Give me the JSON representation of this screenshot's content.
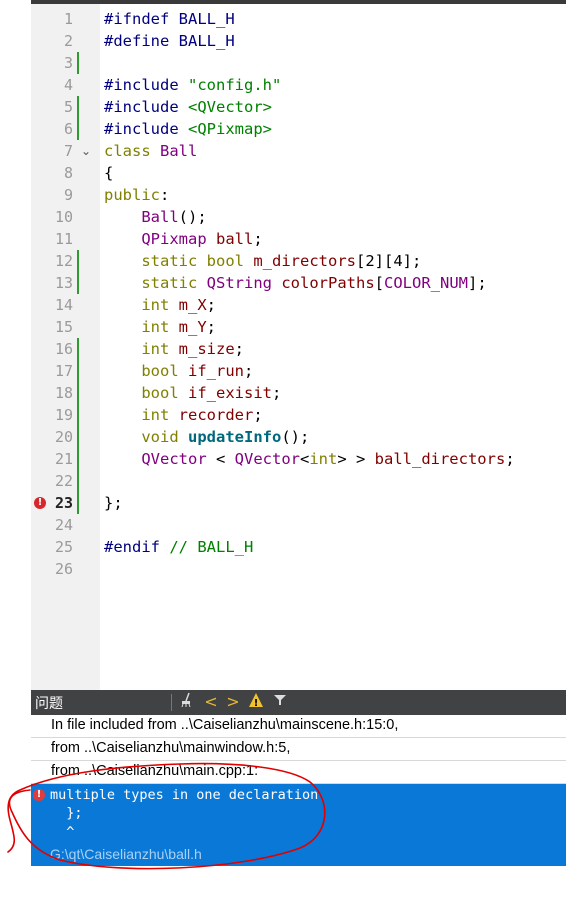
{
  "editor": {
    "lines": [
      {
        "n": "1",
        "mod": false,
        "tokens": [
          {
            "c": "pre",
            "t": "#ifndef BALL_H"
          }
        ]
      },
      {
        "n": "2",
        "mod": false,
        "tokens": [
          {
            "c": "pre",
            "t": "#define BALL_H"
          }
        ]
      },
      {
        "n": "3",
        "mod": true,
        "tokens": []
      },
      {
        "n": "4",
        "mod": false,
        "tokens": [
          {
            "c": "pre",
            "t": "#include "
          },
          {
            "c": "str",
            "t": "\"config.h\""
          }
        ]
      },
      {
        "n": "5",
        "mod": true,
        "tokens": [
          {
            "c": "pre",
            "t": "#include "
          },
          {
            "c": "str",
            "t": "<QVector>"
          }
        ]
      },
      {
        "n": "6",
        "mod": true,
        "tokens": [
          {
            "c": "pre",
            "t": "#include "
          },
          {
            "c": "str",
            "t": "<QPixmap>"
          }
        ]
      },
      {
        "n": "7",
        "mod": false,
        "fold": true,
        "tokens": [
          {
            "c": "kw",
            "t": "class "
          },
          {
            "c": "type",
            "t": "Ball"
          }
        ]
      },
      {
        "n": "8",
        "mod": false,
        "tokens": [
          {
            "c": "plain",
            "t": "{"
          }
        ]
      },
      {
        "n": "9",
        "mod": false,
        "tokens": [
          {
            "c": "kw",
            "t": "public"
          },
          {
            "c": "plain",
            "t": ":"
          }
        ]
      },
      {
        "n": "10",
        "mod": false,
        "tokens": [
          {
            "c": "plain",
            "t": "    "
          },
          {
            "c": "type",
            "t": "Ball"
          },
          {
            "c": "plain",
            "t": "();"
          }
        ]
      },
      {
        "n": "11",
        "mod": false,
        "tokens": [
          {
            "c": "plain",
            "t": "    "
          },
          {
            "c": "type",
            "t": "QPixmap"
          },
          {
            "c": "plain",
            "t": " "
          },
          {
            "c": "field",
            "t": "ball"
          },
          {
            "c": "plain",
            "t": ";"
          }
        ]
      },
      {
        "n": "12",
        "mod": true,
        "tokens": [
          {
            "c": "plain",
            "t": "    "
          },
          {
            "c": "kw",
            "t": "static"
          },
          {
            "c": "plain",
            "t": " "
          },
          {
            "c": "kw",
            "t": "bool"
          },
          {
            "c": "plain",
            "t": " "
          },
          {
            "c": "field",
            "t": "m_directors"
          },
          {
            "c": "plain",
            "t": "[2][4];"
          }
        ]
      },
      {
        "n": "13",
        "mod": true,
        "tokens": [
          {
            "c": "plain",
            "t": "    "
          },
          {
            "c": "kw",
            "t": "static"
          },
          {
            "c": "plain",
            "t": " "
          },
          {
            "c": "type",
            "t": "QString"
          },
          {
            "c": "plain",
            "t": " "
          },
          {
            "c": "field",
            "t": "colorPaths"
          },
          {
            "c": "plain",
            "t": "["
          },
          {
            "c": "type",
            "t": "COLOR_NUM"
          },
          {
            "c": "plain",
            "t": "];"
          }
        ]
      },
      {
        "n": "14",
        "mod": false,
        "tokens": [
          {
            "c": "plain",
            "t": "    "
          },
          {
            "c": "kw",
            "t": "int"
          },
          {
            "c": "plain",
            "t": " "
          },
          {
            "c": "field",
            "t": "m_X"
          },
          {
            "c": "plain",
            "t": ";"
          }
        ]
      },
      {
        "n": "15",
        "mod": false,
        "tokens": [
          {
            "c": "plain",
            "t": "    "
          },
          {
            "c": "kw",
            "t": "int"
          },
          {
            "c": "plain",
            "t": " "
          },
          {
            "c": "field",
            "t": "m_Y"
          },
          {
            "c": "plain",
            "t": ";"
          }
        ]
      },
      {
        "n": "16",
        "mod": true,
        "tokens": [
          {
            "c": "plain",
            "t": "    "
          },
          {
            "c": "kw",
            "t": "int"
          },
          {
            "c": "plain",
            "t": " "
          },
          {
            "c": "field",
            "t": "m_size"
          },
          {
            "c": "plain",
            "t": ";"
          }
        ]
      },
      {
        "n": "17",
        "mod": true,
        "tokens": [
          {
            "c": "plain",
            "t": "    "
          },
          {
            "c": "kw",
            "t": "bool"
          },
          {
            "c": "plain",
            "t": " "
          },
          {
            "c": "field",
            "t": "if_run"
          },
          {
            "c": "plain",
            "t": ";"
          }
        ]
      },
      {
        "n": "18",
        "mod": true,
        "tokens": [
          {
            "c": "plain",
            "t": "    "
          },
          {
            "c": "kw",
            "t": "bool"
          },
          {
            "c": "plain",
            "t": " "
          },
          {
            "c": "field",
            "t": "if_exisit"
          },
          {
            "c": "plain",
            "t": ";"
          }
        ]
      },
      {
        "n": "19",
        "mod": true,
        "tokens": [
          {
            "c": "plain",
            "t": "    "
          },
          {
            "c": "kw",
            "t": "int"
          },
          {
            "c": "plain",
            "t": " "
          },
          {
            "c": "field",
            "t": "recorder"
          },
          {
            "c": "plain",
            "t": ";"
          }
        ]
      },
      {
        "n": "20",
        "mod": true,
        "tokens": [
          {
            "c": "plain",
            "t": "    "
          },
          {
            "c": "kw",
            "t": "void"
          },
          {
            "c": "plain",
            "t": " "
          },
          {
            "c": "fn",
            "t": "updateInfo"
          },
          {
            "c": "plain",
            "t": "();"
          }
        ]
      },
      {
        "n": "21",
        "mod": true,
        "tokens": [
          {
            "c": "plain",
            "t": "    "
          },
          {
            "c": "type",
            "t": "QVector"
          },
          {
            "c": "plain",
            "t": " < "
          },
          {
            "c": "type",
            "t": "QVector"
          },
          {
            "c": "plain",
            "t": "<"
          },
          {
            "c": "kw",
            "t": "int"
          },
          {
            "c": "plain",
            "t": "> > "
          },
          {
            "c": "field",
            "t": "ball_directors"
          },
          {
            "c": "plain",
            "t": ";"
          }
        ]
      },
      {
        "n": "22",
        "mod": true,
        "tokens": []
      },
      {
        "n": "23",
        "mod": true,
        "error": true,
        "tokens": [
          {
            "c": "plain",
            "t": "};"
          }
        ]
      },
      {
        "n": "24",
        "mod": false,
        "tokens": []
      },
      {
        "n": "25",
        "mod": false,
        "tokens": [
          {
            "c": "pre",
            "t": "#endif "
          },
          {
            "c": "cm",
            "t": "// BALL_H"
          }
        ]
      },
      {
        "n": "26",
        "mod": false,
        "tokens": []
      }
    ]
  },
  "issues_panel": {
    "title": "问题",
    "toolbar": {
      "clear_icon": "broom-icon",
      "prev_label": "<",
      "next_label": ">",
      "warning_label": "!",
      "filter_icon": "filter-icon"
    },
    "rows": [
      "In file included from ..\\Caiselianzhu\\mainscene.h:15:0,",
      "from ..\\Caiselianzhu\\mainwindow.h:5,",
      "from ..\\Caiselianzhu\\main.cpp:1:"
    ],
    "selected": {
      "message": "multiple types in one declaration",
      "code_line": "  };",
      "caret": "  ^",
      "file": "G:\\qt\\Caiselianzhu\\ball.h"
    }
  },
  "colors": {
    "selection": "#0a78d7",
    "panel_header": "#404244",
    "modified_bar": "#2f9a2f",
    "error": "#d9262b",
    "annotation": "#e00000"
  }
}
